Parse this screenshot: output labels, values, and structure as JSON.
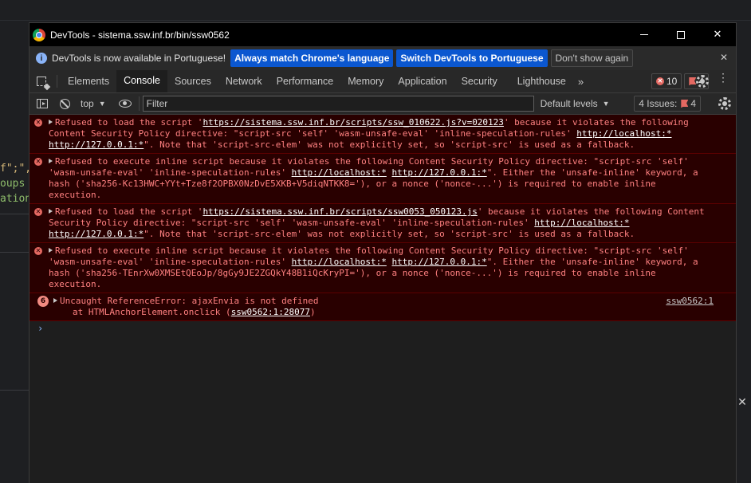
{
  "background": {
    "code_lines": [
      "f\";\",",
      "oups",
      "ation"
    ],
    "close_glyph": "✕"
  },
  "window": {
    "title": "DevTools - sistema.ssw.inf.br/bin/ssw0562",
    "minimize": "",
    "maximize": "",
    "close": "✕"
  },
  "infobar": {
    "icon": "i",
    "text": "DevTools is now available in Portuguese!",
    "btn_match": "Always match Chrome's language",
    "btn_switch": "Switch DevTools to Portuguese",
    "btn_dismiss": "Don't show again",
    "close": "✕"
  },
  "tabs": {
    "items": [
      "Elements",
      "Console",
      "Sources",
      "Network",
      "Performance",
      "Memory",
      "Application",
      "Security",
      "Lighthouse"
    ],
    "active": "Console",
    "more": "»",
    "errors_count": "10",
    "issues_count": "4",
    "kebab": "⋮"
  },
  "toolbar": {
    "context": "top",
    "caret": "▼",
    "filter_placeholder": "Filter",
    "levels": "Default levels",
    "issues_label": "4 Issues:",
    "issues_count": "4"
  },
  "console": {
    "messages": [
      {
        "parts": [
          {
            "t": "Refused to load the script '"
          },
          {
            "t": "https://sistema.ssw.inf.br/scripts/ssw_010622.js?v=020123",
            "link": true
          },
          {
            "t": "' because it violates the following Content Security Policy directive: \"script-src 'self' 'wasm-unsafe-eval' 'inline-speculation-rules' "
          },
          {
            "t": "http://localhost:*",
            "link": true
          },
          {
            "t": " "
          },
          {
            "t": "http://127.0.0.1:*",
            "link": true
          },
          {
            "t": "\". Note that 'script-src-elem' was not explicitly set, so 'script-src' is used as a fallback."
          }
        ]
      },
      {
        "parts": [
          {
            "t": "Refused to execute inline script because it violates the following Content Security Policy directive: \"script-src 'self' 'wasm-unsafe-eval' 'inline-speculation-rules' "
          },
          {
            "t": "http://localhost:*",
            "link": true
          },
          {
            "t": " "
          },
          {
            "t": "http://127.0.0.1:*",
            "link": true
          },
          {
            "t": "\". Either the 'unsafe-inline' keyword, a hash ('sha256-Kc13HWC+YYt+Tze8f2OPBX0NzDvE5XKB+V5diqNTKK8='), or a nonce ('nonce-...') is required to enable inline execution."
          }
        ]
      },
      {
        "parts": [
          {
            "t": "Refused to load the script '"
          },
          {
            "t": "https://sistema.ssw.inf.br/scripts/ssw0053_050123.js",
            "link": true
          },
          {
            "t": "' because it violates the following Content Security Policy directive: \"script-src 'self' 'wasm-unsafe-eval' 'inline-speculation-rules' "
          },
          {
            "t": "http://localhost:*",
            "link": true
          },
          {
            "t": " "
          },
          {
            "t": "http://127.0.0.1:*",
            "link": true
          },
          {
            "t": "\". Note that 'script-src-elem' was not explicitly set, so 'script-src' is used as a fallback."
          }
        ]
      },
      {
        "parts": [
          {
            "t": "Refused to execute inline script because it violates the following Content Security Policy directive: \"script-src 'self' 'wasm-unsafe-eval' 'inline-speculation-rules' "
          },
          {
            "t": "http://localhost:*",
            "link": true
          },
          {
            "t": " "
          },
          {
            "t": "http://127.0.0.1:*",
            "link": true
          },
          {
            "t": "\". Either the 'unsafe-inline' keyword, a hash ('sha256-TEnrXw0XMSEtQEoJp/8gGy9JE2ZGQkY48B1iQcKryPI='), or a nonce ('nonce-...') is required to enable inline execution."
          }
        ]
      }
    ],
    "uncaught": {
      "count": "6",
      "text": "Uncaught ReferenceError: ajaxEnvia is not defined",
      "source": "ssw0562:1",
      "stack_prefix": "at HTMLAnchorElement.onclick (",
      "stack_link": "ssw0562:1:28077",
      "stack_suffix": ")"
    },
    "prompt": "›"
  },
  "colors": {
    "error_bg": "#290000",
    "error_text": "#ff8080",
    "accent_button": "#0b57d0"
  }
}
